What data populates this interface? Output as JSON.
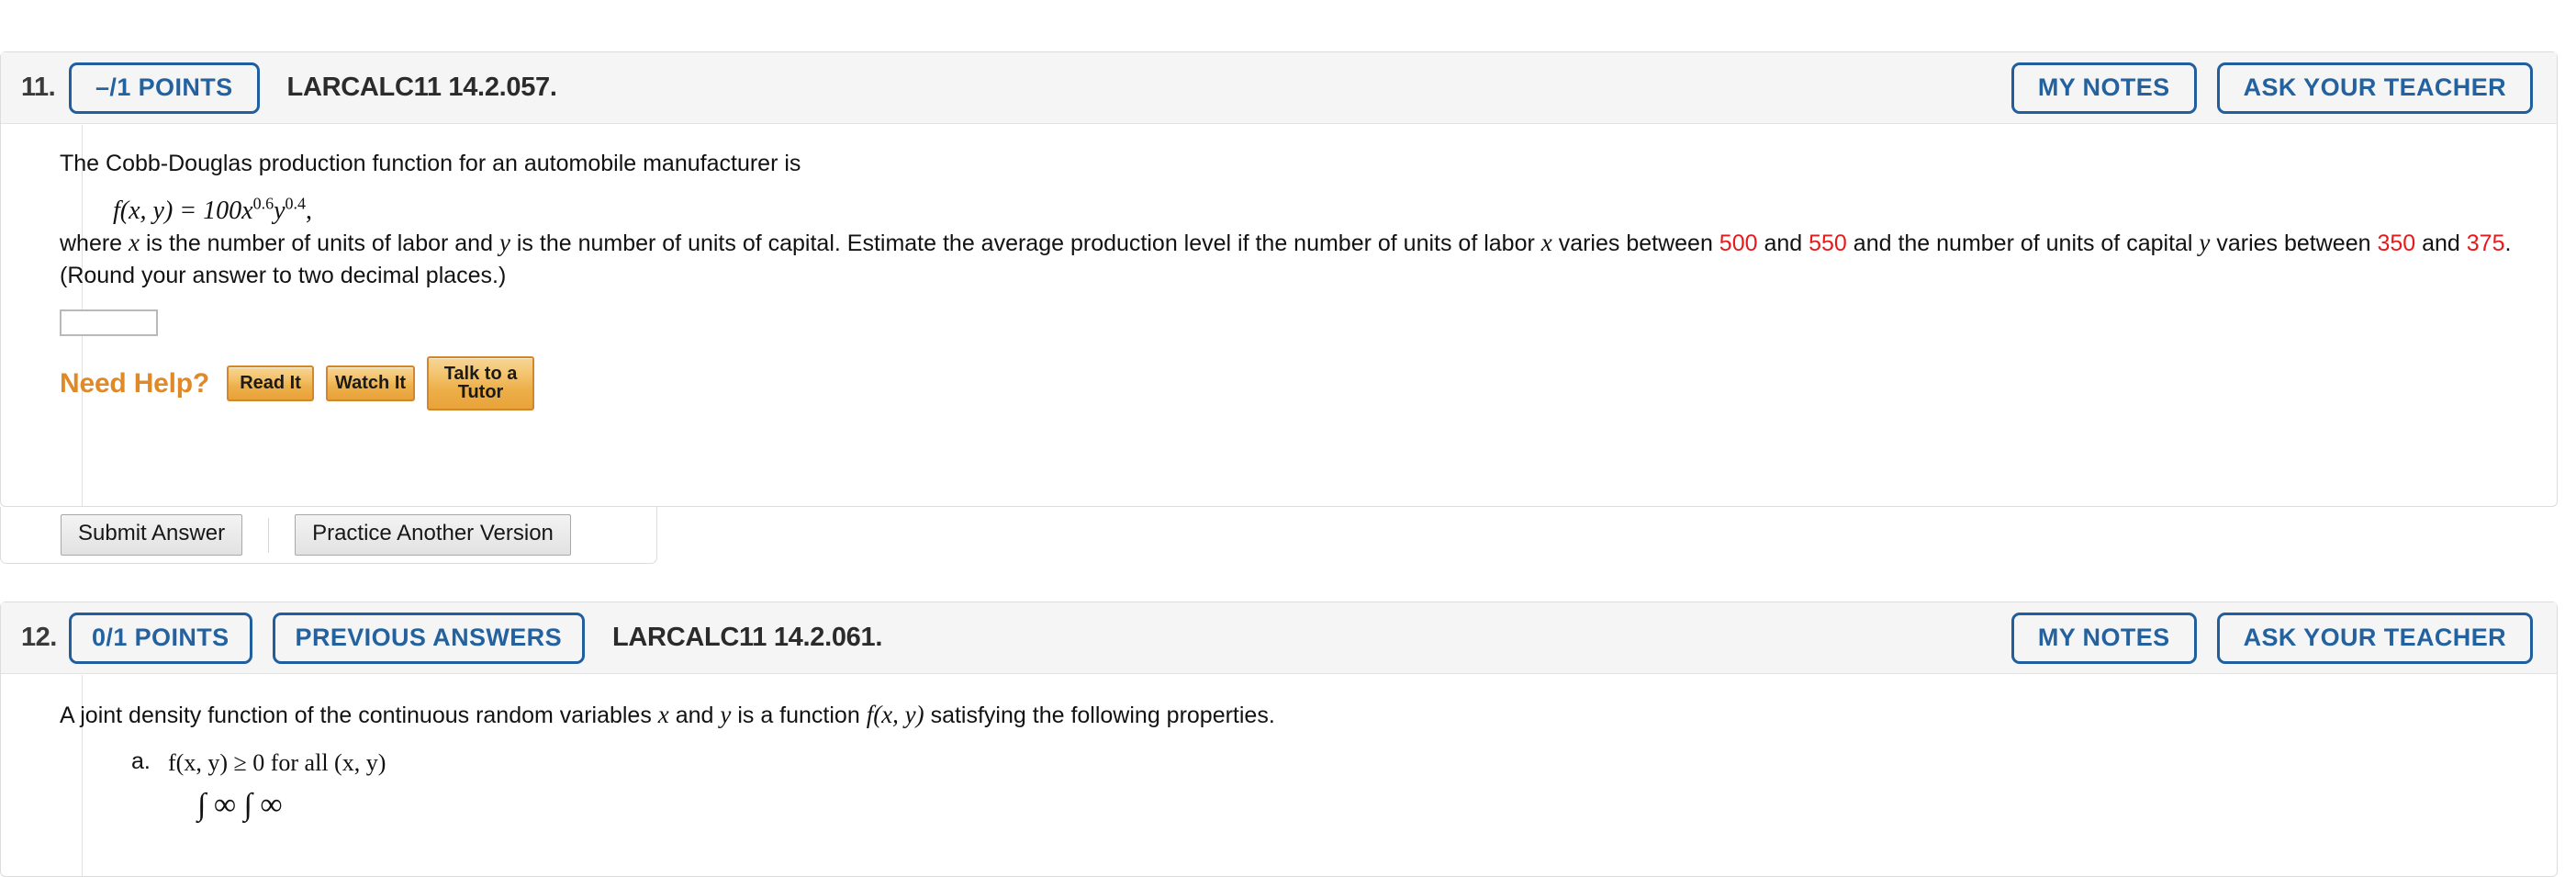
{
  "questions": [
    {
      "number": "11.",
      "points_label": "–/1 POINTS",
      "code": "LARCALC11 14.2.057.",
      "my_notes_label": "MY NOTES",
      "ask_teacher_label": "ASK YOUR TEACHER",
      "prompt_line1": "The Cobb-Douglas production function for an automobile manufacturer is",
      "formula": {
        "lhs": "f(x, y) = 100x",
        "exp1": "0.6",
        "mid": "y",
        "exp2": "0.4",
        "tail": ","
      },
      "prompt_part_a": "where ",
      "prompt_var_x": "x",
      "prompt_part_b": " is the number of units of labor and ",
      "prompt_var_y": "y",
      "prompt_part_c": " is the number of units of capital. Estimate the average production level if the number of units of labor ",
      "prompt_var_x2": "x",
      "prompt_part_d": " varies between ",
      "range_x_min": "500",
      "prompt_and_1": " and ",
      "range_x_max": "550",
      "prompt_part_e": " and the number of units of capital ",
      "prompt_var_y2": "y",
      "prompt_part_f": " varies between ",
      "range_y_min": "350",
      "prompt_and_2": " and ",
      "range_y_max": "375",
      "prompt_part_g": ". (Round your answer to two decimal places.)",
      "answer_value": "",
      "answer_placeholder": "",
      "need_help_label": "Need Help?",
      "help_buttons": [
        {
          "label": "Read It"
        },
        {
          "label": "Watch It"
        },
        {
          "label": "Talk to a Tutor"
        }
      ],
      "submit_label": "Submit Answer",
      "practice_label": "Practice Another Version"
    },
    {
      "number": "12.",
      "points_label": "0/1 POINTS",
      "previous_answers_label": "PREVIOUS ANSWERS",
      "code": "LARCALC11 14.2.061.",
      "my_notes_label": "MY NOTES",
      "ask_teacher_label": "ASK YOUR TEACHER",
      "prompt_part_a": "A joint density function of the continuous random variables ",
      "prompt_var_x": "x",
      "prompt_part_b": " and ",
      "prompt_var_y": "y",
      "prompt_part_c": " is a function ",
      "prompt_fn": "f(x, y)",
      "prompt_part_d": " satisfying the following properties.",
      "properties": [
        {
          "marker": "a.",
          "text": "f(x, y) ≥ 0 for all (x, y)"
        }
      ],
      "integral_partial": "∫ ∞  ∫ ∞"
    }
  ]
}
